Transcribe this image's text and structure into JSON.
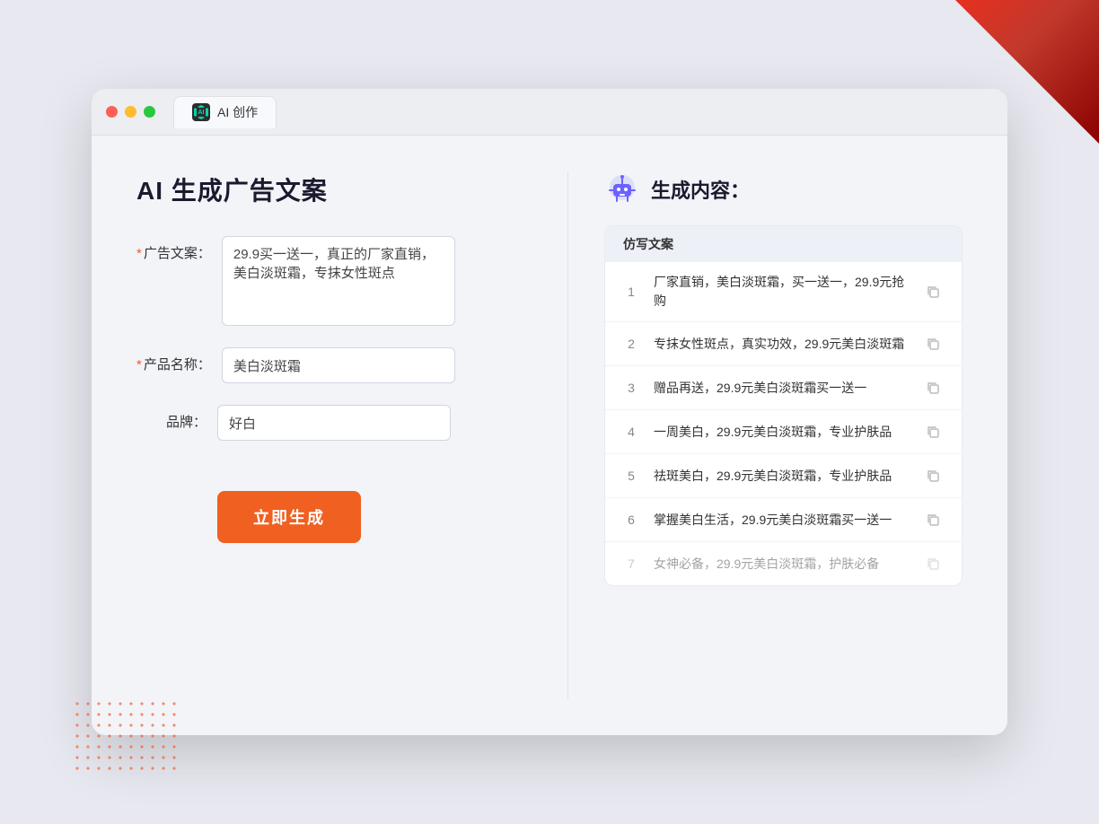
{
  "window": {
    "tab_label": "AI 创作"
  },
  "page": {
    "title": "AI 生成广告文案",
    "right_title": "生成内容："
  },
  "form": {
    "ad_copy_label": "广告文案：",
    "ad_copy_required": "*",
    "ad_copy_value": "29.9买一送一，真正的厂家直销，美白淡斑霜，专抹女性斑点",
    "product_name_label": "产品名称：",
    "product_name_required": "*",
    "product_name_value": "美白淡斑霜",
    "brand_label": "品牌：",
    "brand_value": "好白",
    "generate_button": "立即生成"
  },
  "results": {
    "table_header": "仿写文案",
    "items": [
      {
        "num": "1",
        "text": "厂家直销，美白淡斑霜，买一送一，29.9元抢购"
      },
      {
        "num": "2",
        "text": "专抹女性斑点，真实功效，29.9元美白淡斑霜"
      },
      {
        "num": "3",
        "text": "赠品再送，29.9元美白淡斑霜买一送一"
      },
      {
        "num": "4",
        "text": "一周美白，29.9元美白淡斑霜，专业护肤品"
      },
      {
        "num": "5",
        "text": "祛斑美白，29.9元美白淡斑霜，专业护肤品"
      },
      {
        "num": "6",
        "text": "掌握美白生活，29.9元美白淡斑霜买一送一"
      },
      {
        "num": "7",
        "text": "女神必备，29.9元美白淡斑霜，护肤必备"
      }
    ]
  },
  "colors": {
    "accent": "#f06020",
    "brand": "#00d4aa",
    "dark": "#2d2d2d"
  }
}
